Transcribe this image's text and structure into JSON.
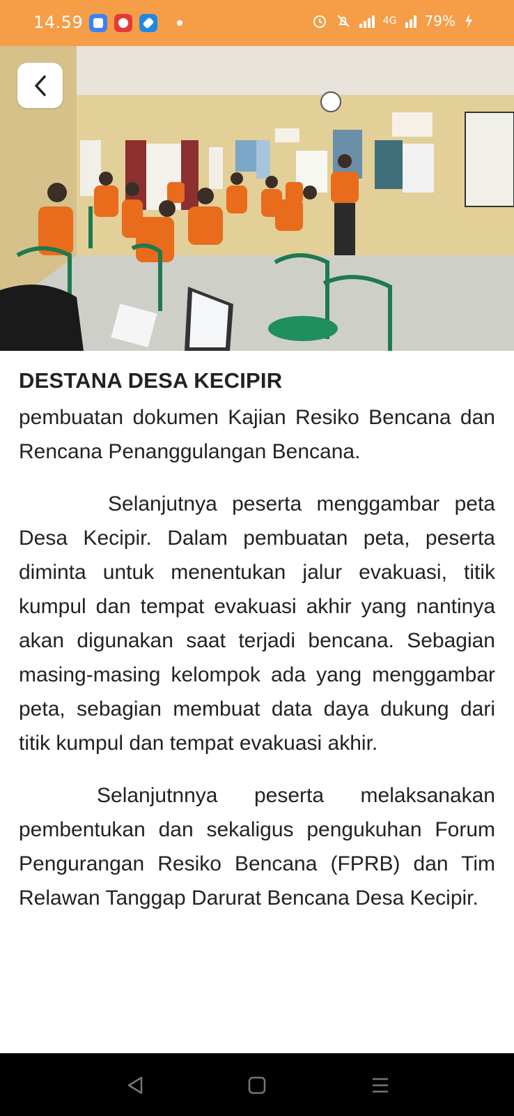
{
  "status_bar": {
    "time": "14.59",
    "network": "4G",
    "battery": "79%",
    "icons": [
      "app-icon-blue",
      "app-icon-red",
      "app-icon-blue-edit",
      "alarm-icon",
      "mute-icon",
      "signal-icon",
      "signal-4g-icon",
      "battery-charging-icon"
    ],
    "background_color": "#F59D47"
  },
  "header": {
    "image_description_icon": "photo-image",
    "back_icon": "chevron-left-icon"
  },
  "article": {
    "title": "DESTANA DESA KECIPIR",
    "paragraphs": [
      "pembuatan dokumen Kajian Resiko Bencana dan Rencana Penanggulangan Bencana.",
      "Selanjutnya peserta menggambar peta Desa Kecipir. Dalam pembuatan peta, peserta diminta untuk menentukan jalur evakuasi, titik kumpul dan tempat evakuasi akhir yang nantinya akan digunakan saat terjadi bencana. Sebagian masing-masing kelompok ada yang menggambar peta, sebagian membuat data daya dukung dari titik kumpul dan tempat evakuasi akhir.",
      "Selanjutnnya peserta melaksanakan pembentukan dan sekaligus pengukuhan Forum Pengurangan Resiko Bencana (FPRB) dan Tim Relawan Tanggap Darurat Bencana Desa Kecipir."
    ]
  },
  "nav_bar": {
    "buttons": [
      "back-triangle-icon",
      "home-square-icon",
      "recents-lines-icon"
    ]
  }
}
